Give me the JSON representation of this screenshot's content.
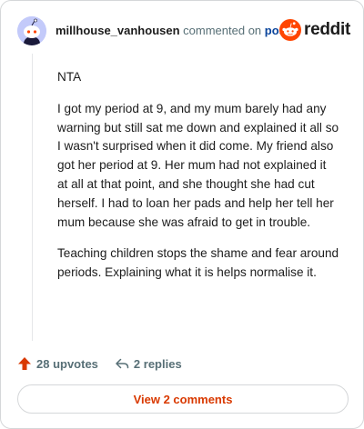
{
  "header": {
    "username": "millhouse_vanhousen",
    "action_text": "commented on",
    "post_link": "post",
    "brand": "reddit"
  },
  "comment": {
    "paragraphs": [
      "NTA",
      "I got my period at 9, and my mum barely had any warning but still sat me down and explained it all so I wasn't surprised when it did come. My friend also got her period at 9. Her mum had not explained it at all at that point, and she thought she had cut herself. I had to loan her pads and help her tell her mum because she was afraid to get in trouble.",
      "Teaching children stops the shame and fear around periods. Explaining what it is helps normalise it."
    ]
  },
  "actions": {
    "upvotes": "28 upvotes",
    "replies": "2 replies"
  },
  "view_button": "View 2 comments",
  "colors": {
    "upvote": "#d93900",
    "link": "#0a449b",
    "reddit_orange": "#ff4500",
    "avatar_bg": "#c3cafa"
  },
  "icons": {
    "avatar": "snoo-avatar-icon",
    "logo": "reddit-logo-icon",
    "upvote": "upvote-arrow-icon",
    "reply": "reply-arrow-icon"
  }
}
